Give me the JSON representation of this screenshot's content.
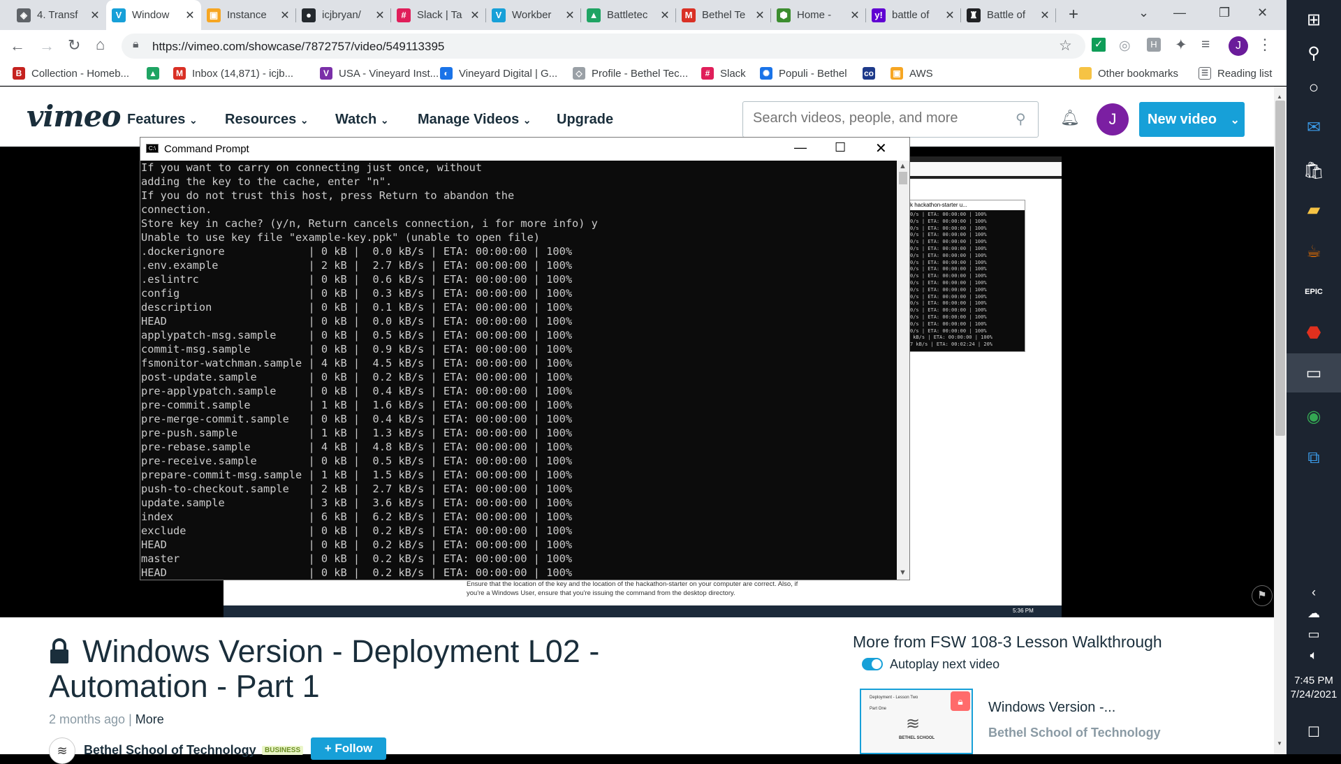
{
  "tabs": [
    {
      "title": "4. Transf",
      "fav": "shield-icon",
      "color": "#5f6368",
      "glyph": "◈"
    },
    {
      "title": "Window",
      "fav": "vimeo-icon",
      "color": "#17a0d8",
      "glyph": "V"
    },
    {
      "title": "Instance",
      "fav": "aws-cube-icon",
      "color": "#f6a623",
      "glyph": "▣"
    },
    {
      "title": "icjbryan/",
      "fav": "github-icon",
      "color": "#24292e",
      "glyph": "●"
    },
    {
      "title": "Slack | Ta",
      "fav": "slack-icon",
      "color": "#e01e5a",
      "glyph": "#"
    },
    {
      "title": "Workber",
      "fav": "vimeo-icon",
      "color": "#17a0d8",
      "glyph": "V"
    },
    {
      "title": "Battletec",
      "fav": "google-drive-icon",
      "color": "#1fa463",
      "glyph": "▲"
    },
    {
      "title": "Bethel Te",
      "fav": "gmail-icon",
      "color": "#d93025",
      "glyph": "M"
    },
    {
      "title": "Home -",
      "fav": "hex-icon",
      "color": "#3c8d2f",
      "glyph": "⬢"
    },
    {
      "title": "battle of",
      "fav": "yahoo-icon",
      "color": "#6001d2",
      "glyph": "y!"
    },
    {
      "title": "Battle of",
      "fav": "soldier-icon",
      "color": "#202124",
      "glyph": "♜"
    }
  ],
  "browser": {
    "url": "https://vimeo.com/showcase/7872757/video/549113395",
    "avatar_letter": "J"
  },
  "bookmarks": [
    {
      "label": "Collection - Homeb...",
      "icon": "b-icon",
      "color": "#c5221f",
      "glyph": "B"
    },
    {
      "label": "",
      "icon": "google-drive-icon",
      "color": "#1fa463",
      "glyph": "▲"
    },
    {
      "label": "Inbox (14,871) - icjb...",
      "icon": "gmail-icon",
      "color": "#d93025",
      "glyph": "M"
    },
    {
      "label": "USA - Vineyard Inst...",
      "icon": "vineyard-icon",
      "color": "#7a2fa8",
      "glyph": "V"
    },
    {
      "label": "Vineyard Digital | G...",
      "icon": "vd-icon",
      "color": "#1a73e8",
      "glyph": "◐"
    },
    {
      "label": "Profile - Bethel Tec...",
      "icon": "profile-icon",
      "color": "#9aa0a6",
      "glyph": "◇"
    },
    {
      "label": "Slack",
      "icon": "slack-icon",
      "color": "#e01e5a",
      "glyph": "#"
    },
    {
      "label": "Populi - Bethel",
      "icon": "populi-icon",
      "color": "#1a73e8",
      "glyph": "✺"
    },
    {
      "label": "",
      "icon": "co-icon",
      "color": "#1e3a8a",
      "glyph": "co"
    },
    {
      "label": "AWS",
      "icon": "aws-cube-icon",
      "color": "#f6a623",
      "glyph": "▣"
    }
  ],
  "bookmarks_right": {
    "other": "Other bookmarks",
    "reading": "Reading list"
  },
  "vimeo": {
    "logo": "vimeo",
    "nav": [
      "Features",
      "Resources",
      "Watch",
      "Manage Videos",
      "Upgrade"
    ],
    "search_placeholder": "Search videos, people, and more",
    "avatar": "J",
    "new_video": "New video"
  },
  "cmd": {
    "title": "Command Prompt",
    "preamble": [
      "If you want to carry on connecting just once, without",
      "adding the key to the cache, enter \"n\".",
      "If you do not trust this host, press Return to abandon the",
      "connection.",
      "Store key in cache? (y/n, Return cancels connection, i for more info) y",
      "Unable to use key file \"example-key.ppk\" (unable to open file)"
    ],
    "files": [
      {
        "name": ".dockerignore",
        "size": "0 kB",
        "rate": "0.0 kB/s",
        "eta": "ETA: 00:00:00",
        "pct": "100%"
      },
      {
        "name": ".env.example",
        "size": "2 kB",
        "rate": "2.7 kB/s",
        "eta": "ETA: 00:00:00",
        "pct": "100%"
      },
      {
        "name": ".eslintrc",
        "size": "0 kB",
        "rate": "0.6 kB/s",
        "eta": "ETA: 00:00:00",
        "pct": "100%"
      },
      {
        "name": "config",
        "size": "0 kB",
        "rate": "0.3 kB/s",
        "eta": "ETA: 00:00:00",
        "pct": "100%"
      },
      {
        "name": "description",
        "size": "0 kB",
        "rate": "0.1 kB/s",
        "eta": "ETA: 00:00:00",
        "pct": "100%"
      },
      {
        "name": "HEAD",
        "size": "0 kB",
        "rate": "0.0 kB/s",
        "eta": "ETA: 00:00:00",
        "pct": "100%"
      },
      {
        "name": "applypatch-msg.sample",
        "size": "0 kB",
        "rate": "0.5 kB/s",
        "eta": "ETA: 00:00:00",
        "pct": "100%"
      },
      {
        "name": "commit-msg.sample",
        "size": "0 kB",
        "rate": "0.9 kB/s",
        "eta": "ETA: 00:00:00",
        "pct": "100%"
      },
      {
        "name": "fsmonitor-watchman.sample",
        "size": "4 kB",
        "rate": "4.5 kB/s",
        "eta": "ETA: 00:00:00",
        "pct": "100%"
      },
      {
        "name": "post-update.sample",
        "size": "0 kB",
        "rate": "0.2 kB/s",
        "eta": "ETA: 00:00:00",
        "pct": "100%"
      },
      {
        "name": "pre-applypatch.sample",
        "size": "0 kB",
        "rate": "0.4 kB/s",
        "eta": "ETA: 00:00:00",
        "pct": "100%"
      },
      {
        "name": "pre-commit.sample",
        "size": "1 kB",
        "rate": "1.6 kB/s",
        "eta": "ETA: 00:00:00",
        "pct": "100%"
      },
      {
        "name": "pre-merge-commit.sample",
        "size": "0 kB",
        "rate": "0.4 kB/s",
        "eta": "ETA: 00:00:00",
        "pct": "100%"
      },
      {
        "name": "pre-push.sample",
        "size": "1 kB",
        "rate": "1.3 kB/s",
        "eta": "ETA: 00:00:00",
        "pct": "100%"
      },
      {
        "name": "pre-rebase.sample",
        "size": "4 kB",
        "rate": "4.8 kB/s",
        "eta": "ETA: 00:00:00",
        "pct": "100%"
      },
      {
        "name": "pre-receive.sample",
        "size": "0 kB",
        "rate": "0.5 kB/s",
        "eta": "ETA: 00:00:00",
        "pct": "100%"
      },
      {
        "name": "prepare-commit-msg.sample",
        "size": "1 kB",
        "rate": "1.5 kB/s",
        "eta": "ETA: 00:00:00",
        "pct": "100%"
      },
      {
        "name": "push-to-checkout.sample",
        "size": "2 kB",
        "rate": "2.7 kB/s",
        "eta": "ETA: 00:00:00",
        "pct": "100%"
      },
      {
        "name": "update.sample",
        "size": "3 kB",
        "rate": "3.6 kB/s",
        "eta": "ETA: 00:00:00",
        "pct": "100%"
      },
      {
        "name": "index",
        "size": "6 kB",
        "rate": "6.2 kB/s",
        "eta": "ETA: 00:00:00",
        "pct": "100%"
      },
      {
        "name": "exclude",
        "size": "0 kB",
        "rate": "0.2 kB/s",
        "eta": "ETA: 00:00:00",
        "pct": "100%"
      },
      {
        "name": "HEAD",
        "size": "0 kB",
        "rate": "0.2 kB/s",
        "eta": "ETA: 00:00:00",
        "pct": "100%"
      },
      {
        "name": "master",
        "size": "0 kB",
        "rate": "0.2 kB/s",
        "eta": "ETA: 00:00:00",
        "pct": "100%"
      },
      {
        "name": "HEAD",
        "size": "0 kB",
        "rate": "0.2 kB/s",
        "eta": "ETA: 00:00:00",
        "pct": "100%"
      }
    ]
  },
  "video_frame": {
    "mini_window_title": "k hackathon-starter u...",
    "caption_line1": "Ensure that the location of the key and the location of the hackathon-starter on your computer are correct. Also, if",
    "caption_line2": "you're a Windows User, ensure that you're issuing the command from the desktop directory.",
    "inner_clock": "5:36 PM"
  },
  "video": {
    "title": "Windows Version - Deployment L02 - Automation - Part 1",
    "age": "2 months ago",
    "more": "More",
    "channel": "Bethel School of Technology",
    "badge": "BUSINESS",
    "follow": "+ Follow"
  },
  "sidebar": {
    "heading": "More from FSW 108-3 Lesson Walkthrough",
    "autoplay": "Autoplay next video",
    "related_title": "Windows Version -...",
    "related_channel": "Bethel School of Technology",
    "thumb_text": [
      "Deployment - Lesson Two",
      "Part One",
      "BETHEL SCHOOL"
    ]
  },
  "taskbar": {
    "time": "7:45 PM",
    "date": "7/24/2021"
  }
}
